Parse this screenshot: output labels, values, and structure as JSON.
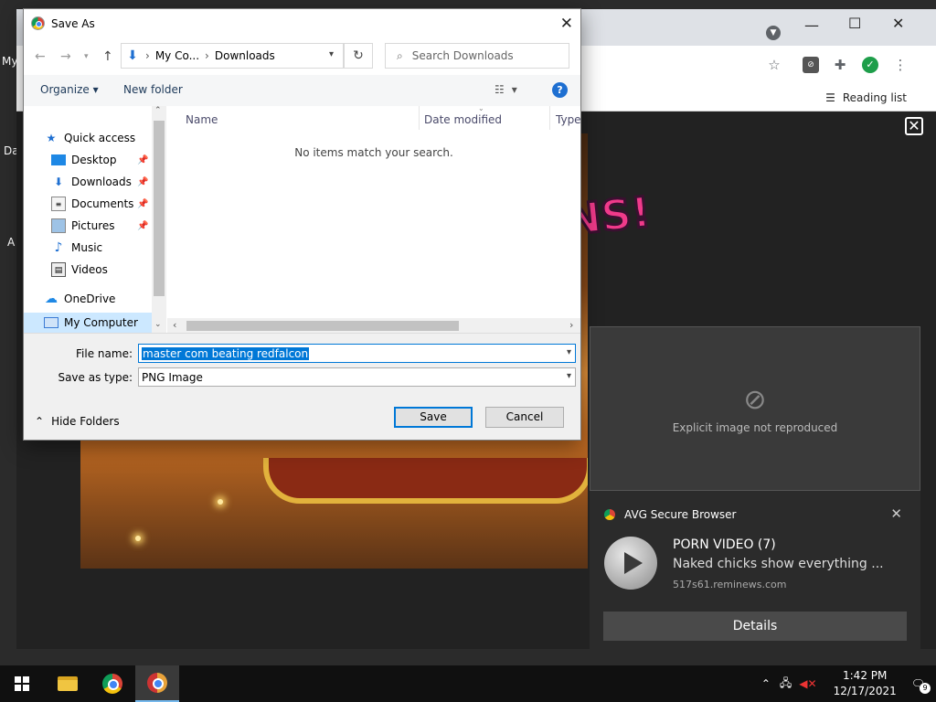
{
  "desktop": {
    "fragment_1": "My",
    "fragment_2": "Da",
    "fragment_3": "A"
  },
  "browser": {
    "bookmark_reading_list": "Reading list",
    "win_minimize": "—",
    "win_maximize": "☐",
    "win_close": "✕"
  },
  "dialog": {
    "title": "Save As",
    "breadcrumb": [
      "My Co...",
      "Downloads"
    ],
    "search_placeholder": "Search Downloads",
    "organize_label": "Organize",
    "new_folder_label": "New folder",
    "nav_items": [
      {
        "label": "Quick access",
        "icon": "star-icon"
      },
      {
        "label": "Desktop",
        "icon": "desktop-icon",
        "pinned": true
      },
      {
        "label": "Downloads",
        "icon": "download-icon",
        "pinned": true
      },
      {
        "label": "Documents",
        "icon": "documents-icon",
        "pinned": true
      },
      {
        "label": "Pictures",
        "icon": "pictures-icon",
        "pinned": true
      },
      {
        "label": "Music",
        "icon": "music-icon"
      },
      {
        "label": "Videos",
        "icon": "videos-icon"
      },
      {
        "label": "OneDrive",
        "icon": "cloud-icon"
      },
      {
        "label": "My Computer",
        "icon": "computer-icon",
        "selected": true
      }
    ],
    "columns": [
      "Name",
      "Date modified",
      "Type"
    ],
    "empty_message": "No items match your search.",
    "file_name_label": "File name:",
    "file_name_value": "master com beating redfalcon",
    "save_type_label": "Save as type:",
    "save_type_value": "PNG Image",
    "hide_folders_label": "Hide Folders",
    "save_label": "Save",
    "cancel_label": "Cancel"
  },
  "ad_blocked": {
    "note": "Explicit image not reproduced"
  },
  "notification": {
    "source": "AVG Secure Browser",
    "title": "PORN VIDEO (7)",
    "body": "Naked chicks show everything ...",
    "url": "517s61.reminews.com",
    "details_label": "Details"
  },
  "taskbar": {
    "time": "1:42 PM",
    "date": "12/17/2021",
    "notification_count": "9"
  }
}
